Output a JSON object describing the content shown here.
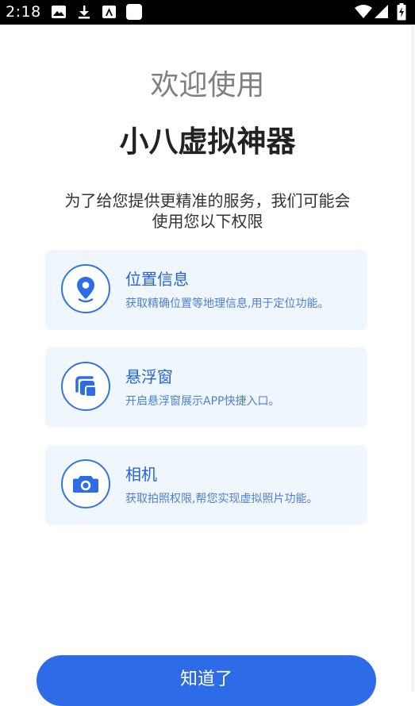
{
  "status_bar": {
    "time": "2:18",
    "left_icons": [
      "image-icon",
      "download-icon",
      "app-notification-icon",
      "square-notification-icon"
    ],
    "right_icons": [
      "wifi-icon",
      "signal-icon",
      "battery-icon"
    ]
  },
  "header": {
    "welcome": "欢迎使用",
    "app_name": "小八虚拟神器"
  },
  "intro": {
    "line1": "为了给您提供更精准的服务，我们可能会",
    "line2": "使用您以下权限"
  },
  "permissions": [
    {
      "icon": "location-pin-icon",
      "title": "位置信息",
      "desc": "获取精确位置等地理信息,用于定位功能。"
    },
    {
      "icon": "floating-window-icon",
      "title": "悬浮窗",
      "desc": "开启悬浮窗展示APP快捷入口。"
    },
    {
      "icon": "camera-icon",
      "title": "相机",
      "desc": "获取拍照权限,帮您实现虚拟照片功能。"
    }
  ],
  "confirm_button": {
    "label": "知道了"
  },
  "colors": {
    "accent": "#2e6be6",
    "card_bg": "#f0f6fd",
    "title_blue": "#2763d8",
    "welcome_gray": "#7f7f7f"
  }
}
